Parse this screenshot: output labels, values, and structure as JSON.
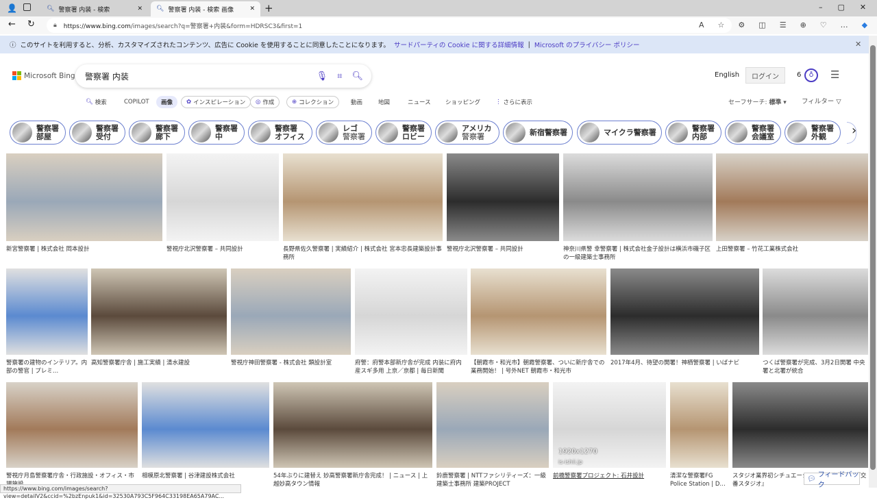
{
  "browser": {
    "tabs": [
      {
        "label": "警察署 内装 - 検索"
      },
      {
        "label": "警察署 内装 - 検索 画像"
      }
    ],
    "url_host": "https://www.bing.com",
    "url_path": "/images/search?q=警察署+内装&form=HDRSC3&first=1"
  },
  "cookie": {
    "text": "このサイトを利用すると、分析、カスタマイズされたコンテンツ、広告に Cookie を使用することに同意したことになります。",
    "link1": "サードパーティの Cookie に関する詳細情報",
    "sep": "|",
    "link2": "Microsoft のプライバシー ポリシー"
  },
  "header": {
    "logo": "Microsoft Bing",
    "query": "警察署 内装",
    "english": "English",
    "login": "ログイン",
    "points": "6"
  },
  "nav": [
    {
      "label": "検索"
    },
    {
      "label": "COPILOT"
    },
    {
      "label": "画像"
    },
    {
      "label": "インスピレーション"
    },
    {
      "label": "作成"
    },
    {
      "label": "コレクション"
    },
    {
      "label": "動画"
    },
    {
      "label": "地図"
    },
    {
      "label": "ニュース"
    },
    {
      "label": "ショッピング"
    },
    {
      "label": "さらに表示"
    }
  ],
  "safesearch": {
    "label": "セーフサーチ:",
    "value": "標準"
  },
  "filter": "フィルター",
  "chips": [
    [
      "警察署",
      "部屋"
    ],
    [
      "警察署",
      "受付"
    ],
    [
      "警察署",
      "廊下"
    ],
    [
      "警察署",
      "中"
    ],
    [
      "警察署",
      "オフィス"
    ],
    [
      "レゴ",
      "警察署"
    ],
    [
      "警察署",
      "ロビー"
    ],
    [
      "アメリカ",
      "警察署"
    ],
    [
      "新宿警察署",
      ""
    ],
    [
      "マイクラ警察署",
      ""
    ],
    [
      "警察署",
      "内部"
    ],
    [
      "警察署",
      "会議室"
    ],
    [
      "警察署",
      "外観"
    ]
  ],
  "results": [
    "新宮警察署 | 株式会社 岡本設計",
    "警視庁北沢警察署 – 共同設計",
    "長野県佐久警察署 | 実績紹介 | 株式会社 宮本忠長建築設計事務所",
    "警視庁北沢警察署 – 共同設計",
    "神奈川県警 幸警察署 | 株式会社金子設計は横浜市磯子区の一級建築士事務所",
    "上田警察署 – 竹花工業株式会社",
    "警察署の建物のインテリア。内部の警官 | プレミ…",
    "高知警察署庁舎 | 施工実績 | 清水建設",
    "警視庁神田警察署 - 株式会社 類設計室",
    "府警：府警本部新庁舎が完成 内装に府内産スギ多用 上京／京都 | 毎日新聞",
    "【朝霞市・和光市】朝霞警察署、ついに新庁舎での業務開始！ | 号外NET 朝霞市・和光市",
    "2017年4月、待望の開署！神栖警察署 | いばナビ",
    "つくば警察署が完成、3月2日開署 中央署と北署が統合",
    "警視庁月島警察署庁舎・行政施設・オフィス・市場施設",
    "相模原北警察署 | 谷津建設株式会社",
    "54年ぶりに建替え 妙高警察署新庁舎完成！ | ニュース | 上越妙高タウン情報",
    "鈴鹿警察署 | NTTファシリティーズ：一級建築士事務所 建築PROJECT",
    "前橋警察署プロジェクト: 石井設計",
    "清潔な警察署FG Police Station | D…",
    "スタジオ業界初シチュエーションに映像制作用『交番スタジオ』"
  ],
  "hover_overlay": {
    "size": "1920x1270",
    "domain": "is-ishii.jp"
  },
  "status_url": "https://www.bing.com/images/search?view=detailV2&ccid=%2bzEnpuk1&id=32530A793C5F964C33198EA65A79AC...",
  "feedback": "フィードバック",
  "colors": {
    "accent": "#4b3cc4",
    "cookie_bg": "#dce6f7"
  }
}
